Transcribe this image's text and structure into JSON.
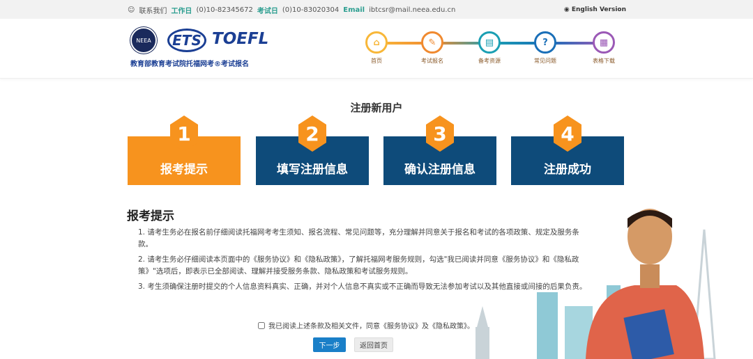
{
  "topbar": {
    "contact": "联系我们",
    "workday_label": "工作日",
    "workday_phone": "(0)10-82345672",
    "examday_label": "考试日",
    "examday_phone": "(0)10-83020304",
    "email_label": "Email",
    "email": "ibtcsr@mail.neea.edu.cn",
    "english": "English Version"
  },
  "header": {
    "seal_text": "NEEA",
    "ets": "ETS",
    "toefl": "TOEFL",
    "tagline": "教育部教育考试院托福网考®考试报名"
  },
  "nav": [
    {
      "label": "首页",
      "icon": "home-icon",
      "color": "#f8b739"
    },
    {
      "label": "考试报名",
      "icon": "pen-icon",
      "color": "#f08a30"
    },
    {
      "label": "备考资源",
      "icon": "calendar-icon",
      "color": "#1b9fb3"
    },
    {
      "label": "常见问题",
      "icon": "question-icon",
      "color": "#1a6fb8"
    },
    {
      "label": "表格下载",
      "icon": "document-icon",
      "color": "#9b59b6"
    }
  ],
  "page_title": "注册新用户",
  "steps": [
    {
      "num": "1",
      "label": "报考提示"
    },
    {
      "num": "2",
      "label": "填写注册信息"
    },
    {
      "num": "3",
      "label": "确认注册信息"
    },
    {
      "num": "4",
      "label": "注册成功"
    }
  ],
  "section_title": "报考提示",
  "terms": [
    "1. 请考生务必在报名前仔细阅读托福网考考生须知、报名流程、常见问题等，充分理解并同意关于报名和考试的各项政策、规定及服务条款。",
    "2. 请考生务必仔细阅读本页面中的《服务协议》和《隐私政策》，了解托福网考服务规则，勾选\"我已阅读并同意《服务协议》和《隐私政策》\"选项后，即表示已全部阅读、理解并接受服务条款、隐私政策和考试服务规则。",
    "3. 考生须确保注册时提交的个人信息资料真实、正确，并对个人信息不真实或不正确而导致无法参加考试以及其他直接或间接的后果负责。"
  ],
  "agree": "我已阅读上述条款及相关文件，同意《服务协议》及《隐私政策》。",
  "buttons": {
    "next": "下一步",
    "home": "返回首页"
  }
}
